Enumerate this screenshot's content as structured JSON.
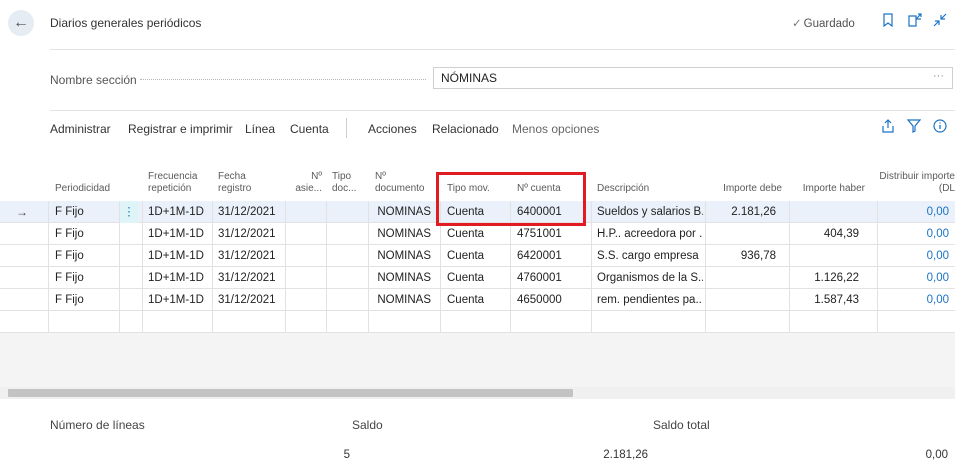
{
  "header": {
    "title": "Diarios generales periódicos",
    "saved": "Guardado"
  },
  "section": {
    "label": "Nombre sección",
    "value": "NÓMINAS",
    "ellipsis": "···"
  },
  "actions": [
    "Administrar",
    "Registrar e imprimir",
    "Línea",
    "Cuenta",
    "Acciones",
    "Relacionado",
    "Menos opciones"
  ],
  "columns": {
    "periodicidad": "Periodicidad",
    "frecuencia": "Frecuencia repetición",
    "fecha": "Fecha registro",
    "asiento": "Nº asie...",
    "tipo_doc": "Tipo doc...",
    "documento": "Nº documento",
    "tipo_mov": "Tipo mov.",
    "cuenta": "Nº cuenta",
    "descripcion": "Descripción",
    "debe": "Importe debe",
    "haber": "Importe haber",
    "distribuir": "Distribuir importe (DL"
  },
  "rows": [
    {
      "periodicidad": "F Fijo",
      "frecuencia": "1D+1M-1D",
      "fecha": "31/12/2021",
      "documento": "NOMINAS",
      "tipo_mov": "Cuenta",
      "cuenta": "6400001",
      "descripcion": "Sueldos y salarios B...",
      "debe": "2.181,26",
      "haber": "",
      "distribuir": "0,00"
    },
    {
      "periodicidad": "F Fijo",
      "frecuencia": "1D+1M-1D",
      "fecha": "31/12/2021",
      "documento": "NOMINAS",
      "tipo_mov": "Cuenta",
      "cuenta": "4751001",
      "descripcion": "H.P.. acreedora por ...",
      "debe": "",
      "haber": "404,39",
      "distribuir": "0,00"
    },
    {
      "periodicidad": "F Fijo",
      "frecuencia": "1D+1M-1D",
      "fecha": "31/12/2021",
      "documento": "NOMINAS",
      "tipo_mov": "Cuenta",
      "cuenta": "6420001",
      "descripcion": "S.S. cargo empresa",
      "debe": "936,78",
      "haber": "",
      "distribuir": "0,00"
    },
    {
      "periodicidad": "F Fijo",
      "frecuencia": "1D+1M-1D",
      "fecha": "31/12/2021",
      "documento": "NOMINAS",
      "tipo_mov": "Cuenta",
      "cuenta": "4760001",
      "descripcion": "Organismos de la S....",
      "debe": "",
      "haber": "1.126,22",
      "distribuir": "0,00"
    },
    {
      "periodicidad": "F Fijo",
      "frecuencia": "1D+1M-1D",
      "fecha": "31/12/2021",
      "documento": "NOMINAS",
      "tipo_mov": "Cuenta",
      "cuenta": "4650000",
      "descripcion": "rem. pendientes pa...",
      "debe": "",
      "haber": "1.587,43",
      "distribuir": "0,00"
    }
  ],
  "footer": {
    "lineas_label": "Número de líneas",
    "saldo_label": "Saldo",
    "saldo_total_label": "Saldo total",
    "lineas_value": "5",
    "saldo_value": "2.181,26",
    "saldo_total_value": "0,00"
  },
  "colors": {
    "accent": "#1c73c4",
    "highlight": "#e11b22"
  },
  "icons": {
    "back": "arrow-left-icon",
    "saved": "check-icon",
    "bookmark": "bookmark-icon",
    "open_new": "open-new-window-icon",
    "collapse": "collapse-icon",
    "share": "share-icon",
    "filter": "filter-icon",
    "info": "info-icon"
  }
}
